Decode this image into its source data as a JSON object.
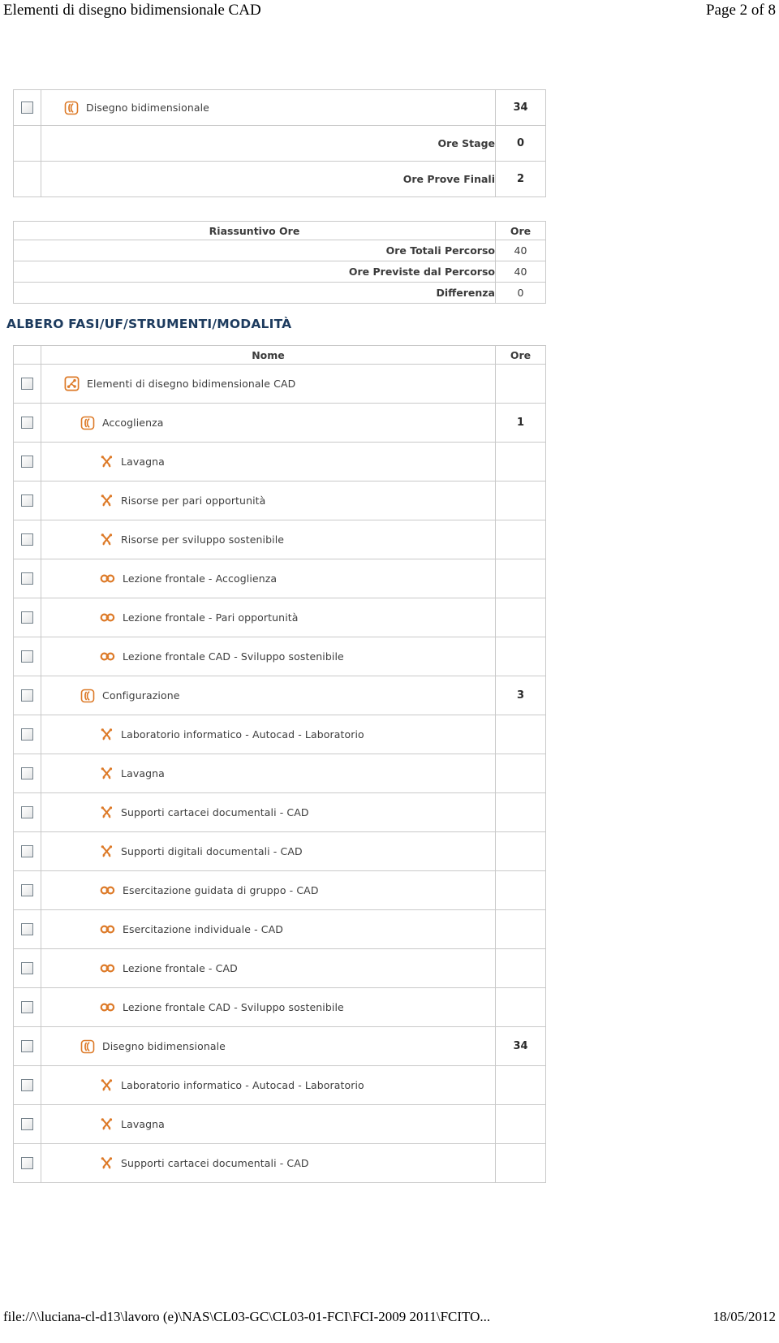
{
  "print_header": {
    "title": "Elementi di disegno bidimensionale CAD",
    "page": "Page 2 of 8"
  },
  "print_footer": {
    "path": "file://\\\\luciana-cl-d13\\lavoro (e)\\NAS\\CL03-GC\\CL03-01-FCI\\FCI-2009 2011\\FCITO...",
    "date": "18/05/2012"
  },
  "colors": {
    "orange": "#dd7a28",
    "heading_navy": "#1d3b5e",
    "border": "#c9c9c9",
    "text": "#3d3d3d"
  },
  "top_table": {
    "rows": [
      {
        "kind": "fase",
        "icon": "phase-icon",
        "label": "Disegno bidimensionale",
        "ore": "34",
        "align": "left",
        "indent": 0
      },
      {
        "kind": "label",
        "icon": "",
        "label": "Ore Stage",
        "ore": "0",
        "align": "right",
        "indent": 0
      },
      {
        "kind": "label",
        "icon": "",
        "label": "Ore Prove Finali",
        "ore": "2",
        "align": "right",
        "indent": 0
      }
    ]
  },
  "riassuntivo_table": {
    "header": {
      "name": "Riassuntivo Ore",
      "ore": "Ore"
    },
    "rows": [
      {
        "label": "Ore Totali Percorso",
        "ore": "40"
      },
      {
        "label": "Ore Previste dal Percorso",
        "ore": "40"
      },
      {
        "label": "Differenza",
        "ore": "0"
      }
    ]
  },
  "albero": {
    "heading": "ALBERO FASI/UF/STRUMENTI/MODALITÀ",
    "header": {
      "name": "Nome",
      "ore": "Ore"
    },
    "rows": [
      {
        "icon": "tree-root-icon",
        "label": "Elementi di disegno bidimensionale CAD",
        "ore": "",
        "indent": 0
      },
      {
        "icon": "phase-icon",
        "label": "Accoglienza",
        "ore": "1",
        "indent": 1
      },
      {
        "icon": "tools-icon",
        "label": "Lavagna",
        "ore": "",
        "indent": 2
      },
      {
        "icon": "tools-icon",
        "label": "Risorse per pari opportunità",
        "ore": "",
        "indent": 2
      },
      {
        "icon": "tools-icon",
        "label": "Risorse per sviluppo sostenibile",
        "ore": "",
        "indent": 2
      },
      {
        "icon": "chainlink-icon",
        "label": "Lezione frontale - Accoglienza",
        "ore": "",
        "indent": 2
      },
      {
        "icon": "chainlink-icon",
        "label": "Lezione frontale - Pari opportunità",
        "ore": "",
        "indent": 2
      },
      {
        "icon": "chainlink-icon",
        "label": "Lezione frontale CAD - Sviluppo sostenibile",
        "ore": "",
        "indent": 2
      },
      {
        "icon": "phase-icon",
        "label": "Configurazione",
        "ore": "3",
        "indent": 1
      },
      {
        "icon": "tools-icon",
        "label": "Laboratorio informatico - Autocad - Laboratorio",
        "ore": "",
        "indent": 2
      },
      {
        "icon": "tools-icon",
        "label": "Lavagna",
        "ore": "",
        "indent": 2
      },
      {
        "icon": "tools-icon",
        "label": "Supporti cartacei documentali - CAD",
        "ore": "",
        "indent": 2
      },
      {
        "icon": "tools-icon",
        "label": "Supporti digitali documentali - CAD",
        "ore": "",
        "indent": 2
      },
      {
        "icon": "chainlink-icon",
        "label": "Esercitazione guidata di gruppo - CAD",
        "ore": "",
        "indent": 2
      },
      {
        "icon": "chainlink-icon",
        "label": "Esercitazione individuale - CAD",
        "ore": "",
        "indent": 2
      },
      {
        "icon": "chainlink-icon",
        "label": "Lezione frontale - CAD",
        "ore": "",
        "indent": 2
      },
      {
        "icon": "chainlink-icon",
        "label": "Lezione frontale CAD - Sviluppo sostenibile",
        "ore": "",
        "indent": 2
      },
      {
        "icon": "phase-icon",
        "label": "Disegno bidimensionale",
        "ore": "34",
        "indent": 1
      },
      {
        "icon": "tools-icon",
        "label": "Laboratorio informatico - Autocad - Laboratorio",
        "ore": "",
        "indent": 2
      },
      {
        "icon": "tools-icon",
        "label": "Lavagna",
        "ore": "",
        "indent": 2
      },
      {
        "icon": "tools-icon",
        "label": "Supporti cartacei documentali - CAD",
        "ore": "",
        "indent": 2
      }
    ]
  }
}
